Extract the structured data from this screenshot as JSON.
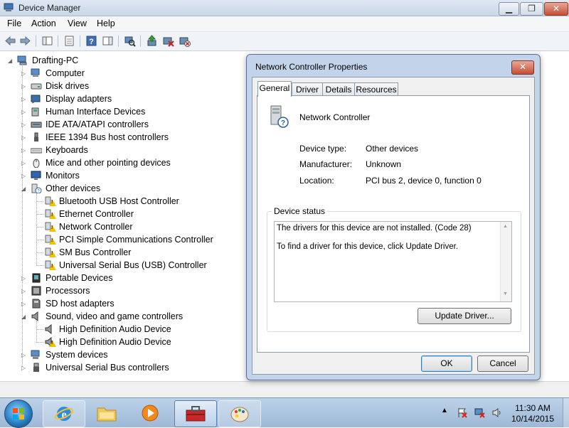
{
  "window": {
    "title": "Device Manager",
    "controls": {
      "minimize": "▁",
      "maximize": "❐",
      "close": "✕"
    }
  },
  "menu": [
    "File",
    "Action",
    "View",
    "Help"
  ],
  "toolbar": {
    "icons": [
      "back-arrow-icon",
      "forward-arrow-icon",
      "show-hide-tree-icon",
      "properties-icon",
      "help-icon",
      "action-pane-icon",
      "scan-hardware-icon",
      "update-driver-icon",
      "disable-device-icon",
      "uninstall-device-icon"
    ]
  },
  "tree": {
    "root": "Drafting-PC",
    "categories": [
      {
        "label": "Computer",
        "expanded": false,
        "icon": "computer-icon"
      },
      {
        "label": "Disk drives",
        "expanded": false,
        "icon": "disk-drive-icon"
      },
      {
        "label": "Display adapters",
        "expanded": false,
        "icon": "display-adapter-icon"
      },
      {
        "label": "Human Interface Devices",
        "expanded": false,
        "icon": "hid-icon"
      },
      {
        "label": "IDE ATA/ATAPI controllers",
        "expanded": false,
        "icon": "ide-controller-icon"
      },
      {
        "label": "IEEE 1394 Bus host controllers",
        "expanded": false,
        "icon": "firewire-icon"
      },
      {
        "label": "Keyboards",
        "expanded": false,
        "icon": "keyboard-icon"
      },
      {
        "label": "Mice and other pointing devices",
        "expanded": false,
        "icon": "mouse-icon"
      },
      {
        "label": "Monitors",
        "expanded": false,
        "icon": "monitor-icon"
      },
      {
        "label": "Other devices",
        "expanded": true,
        "icon": "other-devices-icon",
        "children": [
          {
            "label": "Bluetooth USB Host Controller",
            "warning": true
          },
          {
            "label": "Ethernet Controller",
            "warning": true
          },
          {
            "label": "Network Controller",
            "warning": true
          },
          {
            "label": "PCI Simple Communications Controller",
            "warning": true
          },
          {
            "label": "SM Bus Controller",
            "warning": true
          },
          {
            "label": "Universal Serial Bus (USB) Controller",
            "warning": true
          }
        ]
      },
      {
        "label": "Portable Devices",
        "expanded": false,
        "icon": "portable-device-icon"
      },
      {
        "label": "Processors",
        "expanded": false,
        "icon": "processor-icon"
      },
      {
        "label": "SD host adapters",
        "expanded": false,
        "icon": "sd-adapter-icon"
      },
      {
        "label": "Sound, video and game controllers",
        "expanded": true,
        "icon": "speaker-icon",
        "children": [
          {
            "label": "High Definition Audio Device",
            "warning": false
          },
          {
            "label": "High Definition Audio Device",
            "warning": true
          }
        ]
      },
      {
        "label": "System devices",
        "expanded": false,
        "icon": "system-devices-icon"
      },
      {
        "label": "Universal Serial Bus controllers",
        "expanded": false,
        "icon": "usb-icon"
      }
    ]
  },
  "dialog": {
    "title": "Network Controller Properties",
    "close": "✕",
    "tabs": [
      "General",
      "Driver",
      "Details",
      "Resources"
    ],
    "active_tab": "General",
    "device_name": "Network Controller",
    "fields": [
      {
        "label": "Device type:",
        "value": "Other devices"
      },
      {
        "label": "Manufacturer:",
        "value": "Unknown"
      },
      {
        "label": "Location:",
        "value": "PCI bus 2, device 0, function 0"
      }
    ],
    "status_group_title": "Device status",
    "status_line1": "The drivers for this device are not installed. (Code 28)",
    "status_line2": "To find a driver for this device, click Update Driver.",
    "update_driver": "Update Driver...",
    "ok": "OK",
    "cancel": "Cancel"
  },
  "taskbar": {
    "buttons": [
      "internet-explorer-icon",
      "windows-explorer-icon",
      "media-player-icon",
      "device-manager-toolbox-icon",
      "paint-icon"
    ],
    "active_index": 3,
    "time": "11:30 AM",
    "date": "10/14/2015"
  }
}
